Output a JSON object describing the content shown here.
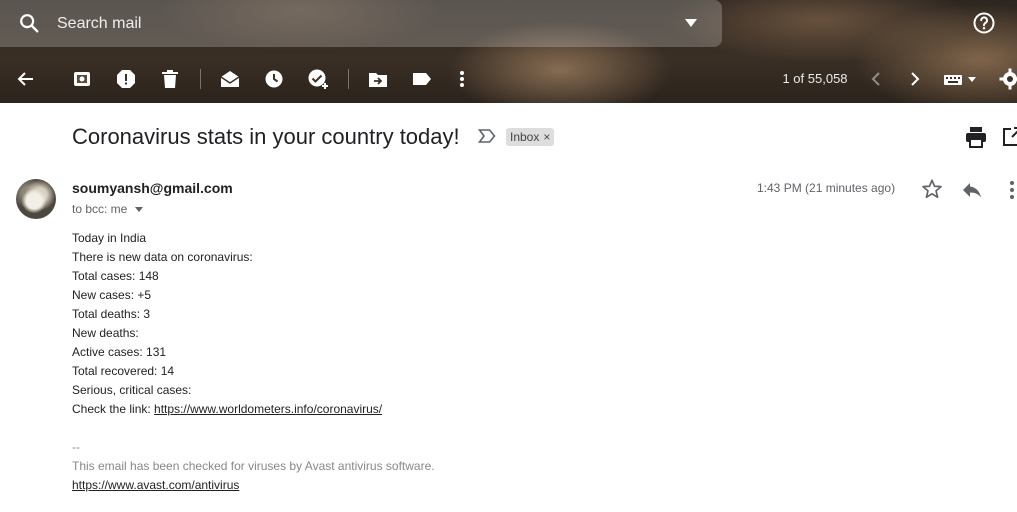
{
  "search": {
    "placeholder": "Search mail"
  },
  "toolbar": {
    "pager_text": "1 of 55,058",
    "icons": [
      "back-arrow-icon",
      "archive-icon",
      "report-spam-icon",
      "delete-icon",
      "mark-unread-icon",
      "snooze-icon",
      "add-to-tasks-icon",
      "move-to-icon",
      "labels-icon",
      "more-vert-icon",
      "newer-icon",
      "older-icon",
      "keyboard-icon",
      "settings-icon"
    ]
  },
  "message": {
    "subject": "Coronavirus stats in your country today!",
    "label_chip": "Inbox",
    "label_chip_close": "×",
    "sender": "soumyansh@gmail.com",
    "recipients": "to bcc: me",
    "timestamp": "1:43 PM (21 minutes ago)",
    "body_lines": [
      "Today in India",
      "There is new data on coronavirus:",
      "Total cases: 148",
      "New cases: +5",
      "Total deaths: 3",
      "New deaths:",
      "Active cases: 131",
      "Total recovered: 14",
      "Serious, critical cases:"
    ],
    "link_prefix": "Check the link: ",
    "link_text": "https://www.worldometers.info/coronavirus/",
    "signature_dash": "--",
    "signature_text": "This email has been checked for viruses by Avast antivirus software.",
    "signature_link": "https://www.avast.com/antivirus"
  },
  "colors": {
    "header_bg": "#2d2620",
    "chip_bg": "#dddddd",
    "text_primary": "#202124",
    "text_secondary": "#5f6368"
  }
}
